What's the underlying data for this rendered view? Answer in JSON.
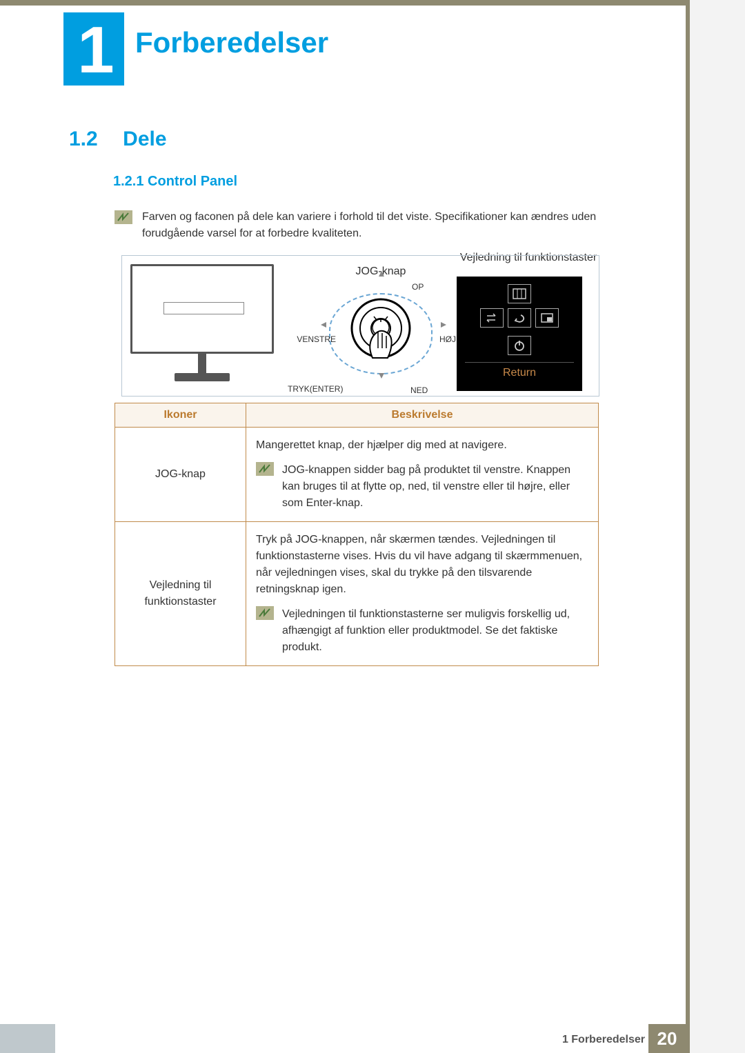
{
  "chapter": {
    "number": "1",
    "title": "Forberedelser"
  },
  "section": {
    "number": "1.2",
    "title": "Dele"
  },
  "subsection": {
    "number": "1.2.1",
    "title": "Control Panel"
  },
  "full_subsection": "1.2.1  Control Panel",
  "info_note": "Farven og faconen på dele kan variere i forhold til det viste. Specifikationer kan ændres uden forudgående varsel for at forbedre kvaliteten.",
  "diagram": {
    "jog_label": "JOG-knap",
    "op": "OP",
    "ned": "NED",
    "venstre": "VENSTRE",
    "hojre": "HØJRE",
    "tryk": "TRYK(ENTER)",
    "guide_caption": "Vejledning til funktionstaster",
    "return": "Return"
  },
  "table": {
    "headers": {
      "icons": "Ikoner",
      "desc": "Beskrivelse"
    },
    "rows": [
      {
        "icon_label": "JOG-knap",
        "desc_main": "Mangerettet knap, der hjælper dig med at navigere.",
        "desc_note": "JOG-knappen sidder bag på produktet til venstre. Knappen kan bruges til at flytte op, ned, til venstre eller til højre, eller som Enter-knap."
      },
      {
        "icon_label": "Vejledning til funktionstaster",
        "desc_main": "Tryk på JOG-knappen, når skærmen tændes. Vejledningen til funktionstasterne vises. Hvis du vil have adgang til skærmmenuen, når vejledningen vises, skal du trykke på den tilsvarende retningsknap igen.",
        "desc_note": "Vejledningen til funktionstasterne ser muligvis forskellig ud, afhængigt af funktion eller produktmodel. Se det faktiske produkt."
      }
    ]
  },
  "footer": {
    "label": "1 Forberedelser",
    "page": "20"
  }
}
